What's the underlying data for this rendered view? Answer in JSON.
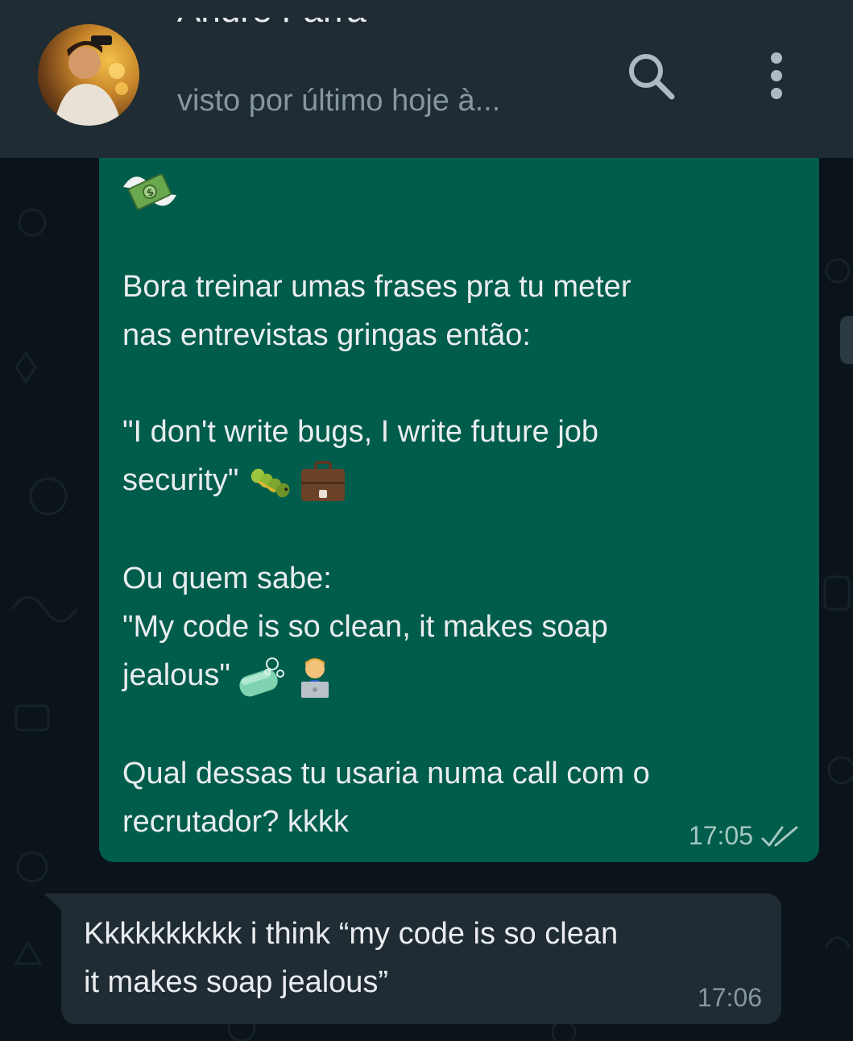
{
  "header": {
    "contact_name": "André Farra",
    "status": "visto por último hoje à...",
    "avatar_icon": "avatar-photo",
    "search_icon": "search-icon",
    "menu_icon": "more-vert-icon"
  },
  "colors": {
    "header_bg": "#202c33",
    "chat_bg": "#0b141a",
    "outgoing_bubble": "#005c4b",
    "incoming_bubble": "#202c33",
    "text_primary": "#e9edef",
    "text_secondary": "#8696a0",
    "read_ticks": "#a5c8bf"
  },
  "messages": [
    {
      "direction": "outgoing",
      "top_emoji": "money-with-wings-emoji",
      "line1": "Bora treinar umas frases pra tu meter",
      "line2": "nas entrevistas gringas então:",
      "line3": "\"I don't write bugs, I write future job",
      "line4": "security\"",
      "line4_emojis": [
        "bug-emoji",
        "briefcase-emoji"
      ],
      "line5": "Ou quem sabe:",
      "line6": "\"My code is so clean, it makes soap",
      "line7": "jealous\"",
      "line7_emojis": [
        "soap-emoji",
        "technologist-emoji"
      ],
      "line8": "Qual dessas tu usaria numa call com o",
      "line9": "recrutador? kkkk",
      "time": "17:05",
      "status_icon": "read-ticks-icon"
    },
    {
      "direction": "incoming",
      "line1": "Kkkkkkkkkk i think “my code is so clean",
      "line2": "it makes soap jealous”",
      "time": "17:06"
    }
  ]
}
